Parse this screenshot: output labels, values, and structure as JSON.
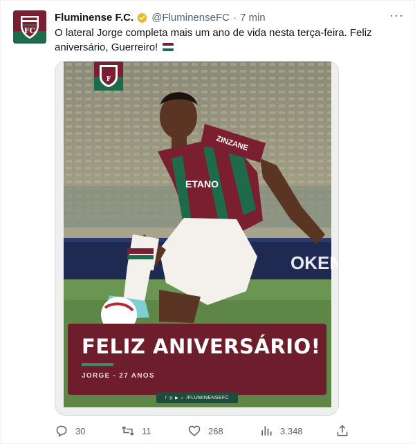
{
  "tweet": {
    "author_name": "Fluminense F.C.",
    "handle": "@FluminenseFC",
    "separator": "·",
    "time": "7 min",
    "text": "O lateral Jorge completa mais um ano de vida nesta terça-feira. Feliz aniversário, Guerreiro!",
    "flag_icon": "flag-fluminense-icon"
  },
  "media": {
    "banner_title": "FELIZ ANIVERSÁRIO!",
    "banner_subtitle": "JORGE - 27 ANOS",
    "social_handle": "/FLUMINENSEFC",
    "social_icons": "f ◎ ▶ ♪",
    "jersey_text": "ZINZANE",
    "sponsor_text": "ETANO",
    "ad_board_text": "OKEN"
  },
  "actions": {
    "replies": "30",
    "retweets": "11",
    "likes": "268",
    "views": "3.348"
  },
  "colors": {
    "brand_maroon": "#7a1f2f",
    "brand_green": "#1e6b4c",
    "verified_gold": "#e8b929",
    "muted_text": "#536471"
  }
}
